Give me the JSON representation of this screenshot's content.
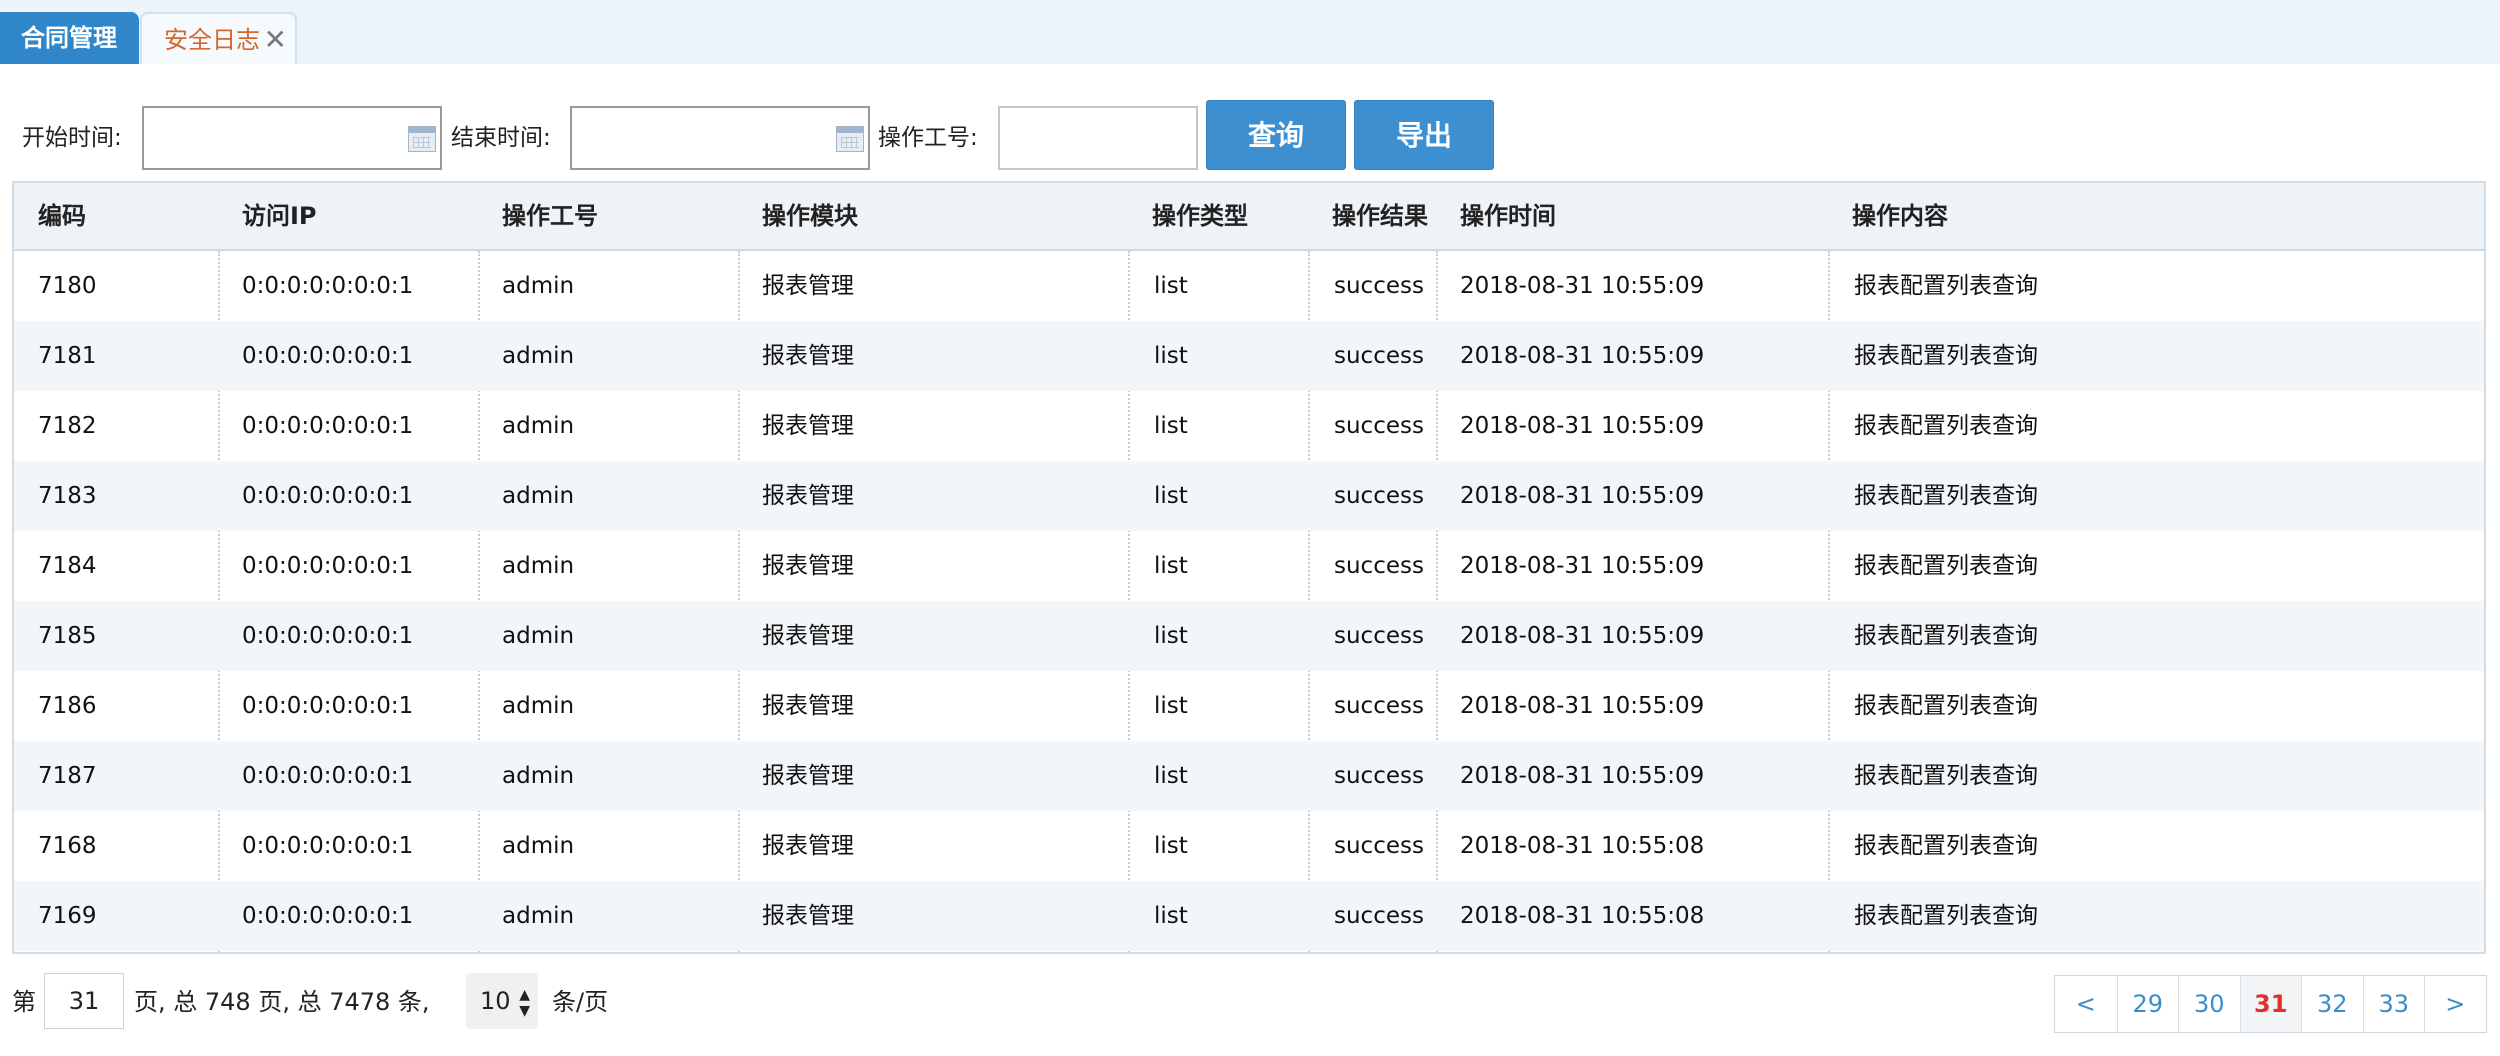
{
  "tabs": [
    {
      "label": "合同管理"
    },
    {
      "label": "安全日志",
      "close": "✕"
    }
  ],
  "filters": {
    "start_label": "开始时间:",
    "start_value": "",
    "end_label": "结束时间:",
    "end_value": "",
    "operator_label": "操作工号:",
    "operator_value": "",
    "query_button": "查询",
    "export_button": "导出"
  },
  "table": {
    "headers": [
      "编码",
      "访问IP",
      "操作工号",
      "操作模块",
      "操作类型",
      "操作结果",
      "操作时间",
      "操作内容"
    ],
    "rows": [
      [
        "7180",
        "0:0:0:0:0:0:0:1",
        "admin",
        "报表管理",
        "list",
        "success",
        "2018-08-31 10:55:09",
        "报表配置列表查询"
      ],
      [
        "7181",
        "0:0:0:0:0:0:0:1",
        "admin",
        "报表管理",
        "list",
        "success",
        "2018-08-31 10:55:09",
        "报表配置列表查询"
      ],
      [
        "7182",
        "0:0:0:0:0:0:0:1",
        "admin",
        "报表管理",
        "list",
        "success",
        "2018-08-31 10:55:09",
        "报表配置列表查询"
      ],
      [
        "7183",
        "0:0:0:0:0:0:0:1",
        "admin",
        "报表管理",
        "list",
        "success",
        "2018-08-31 10:55:09",
        "报表配置列表查询"
      ],
      [
        "7184",
        "0:0:0:0:0:0:0:1",
        "admin",
        "报表管理",
        "list",
        "success",
        "2018-08-31 10:55:09",
        "报表配置列表查询"
      ],
      [
        "7185",
        "0:0:0:0:0:0:0:1",
        "admin",
        "报表管理",
        "list",
        "success",
        "2018-08-31 10:55:09",
        "报表配置列表查询"
      ],
      [
        "7186",
        "0:0:0:0:0:0:0:1",
        "admin",
        "报表管理",
        "list",
        "success",
        "2018-08-31 10:55:09",
        "报表配置列表查询"
      ],
      [
        "7187",
        "0:0:0:0:0:0:0:1",
        "admin",
        "报表管理",
        "list",
        "success",
        "2018-08-31 10:55:09",
        "报表配置列表查询"
      ],
      [
        "7168",
        "0:0:0:0:0:0:0:1",
        "admin",
        "报表管理",
        "list",
        "success",
        "2018-08-31 10:55:08",
        "报表配置列表查询"
      ],
      [
        "7169",
        "0:0:0:0:0:0:0:1",
        "admin",
        "报表管理",
        "list",
        "success",
        "2018-08-31 10:55:08",
        "报表配置列表查询"
      ]
    ]
  },
  "pagination": {
    "prefix": "第",
    "current_page": "31",
    "summary": "页, 总 748 页, 总 7478 条,",
    "page_size": "10",
    "page_size_suffix": "条/页",
    "prev": "<",
    "next": ">",
    "pages": [
      "29",
      "30",
      "31",
      "32",
      "33"
    ],
    "active_page": "31"
  },
  "colors": {
    "active_tab": "#2f86c9",
    "inactive_tab_text": "#d4672a",
    "button": "#3e8fcf",
    "current_page": "#e2312b",
    "page_link": "#3a8ec7"
  },
  "icons": {
    "calendar": "calendar-icon",
    "close": "close-icon",
    "sort_arrows": "updown-arrow-icon"
  }
}
